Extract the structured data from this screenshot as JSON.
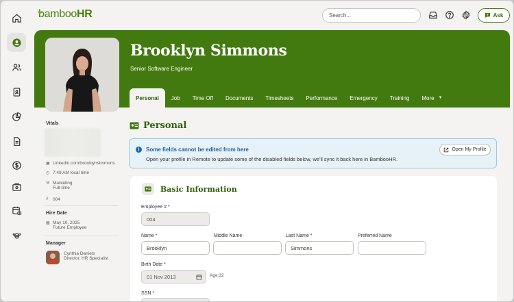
{
  "brand": {
    "logo_prefix": "bamboo",
    "logo_suffix": "HR",
    "accent": "#437a0f"
  },
  "rail": [
    {
      "icon": "home-icon"
    },
    {
      "icon": "user-circle-icon",
      "active": true
    },
    {
      "icon": "people-icon"
    },
    {
      "icon": "id-badge-icon"
    },
    {
      "icon": "pie-chart-icon"
    },
    {
      "icon": "document-icon"
    },
    {
      "icon": "dollar-icon"
    },
    {
      "icon": "payroll-icon"
    },
    {
      "icon": "calendar-clock-icon"
    },
    {
      "icon": "bee-icon"
    }
  ],
  "topbar": {
    "search_placeholder": "Search...",
    "ask_label": "Ask"
  },
  "profile": {
    "name": "Brooklyn Simmons",
    "job_title": "Senior Software Engineer"
  },
  "tabs": [
    {
      "label": "Personal",
      "active": true
    },
    {
      "label": "Job"
    },
    {
      "label": "Time Off"
    },
    {
      "label": "Documents"
    },
    {
      "label": "Timesheets"
    },
    {
      "label": "Performance"
    },
    {
      "label": "Emergency"
    },
    {
      "label": "Training"
    },
    {
      "label": "More"
    }
  ],
  "sidebar": {
    "vitals_label": "Vitals",
    "linkedin": "Linkedin.com/brooklynsimmons",
    "local_time": "7:49 AM local time",
    "department": "Marketing",
    "employment_type": "Full-time",
    "employee_number": "004",
    "hire_date_label": "Hire Date",
    "hire_date": "May 10, 2025",
    "hire_status": "Future Employee",
    "manager_label": "Manager",
    "manager_name": "Cynthia Daniels",
    "manager_title": "Director, HR Specialist"
  },
  "section": {
    "title": "Personal"
  },
  "notice": {
    "title": "Some fields cannot be edited from here",
    "body": "Open your profile in Remote to update some of the disabled fields below, we'll sync it back here in BambooHR.",
    "button_label": "Open My Profile",
    "color": "#1d6db3"
  },
  "basic_info": {
    "title": "Basic Information",
    "employee_number_label": "Employee # *",
    "employee_number_value": "004",
    "name_label": "Name *",
    "name_value": "Brooklyn",
    "middle_name_label": "Middle Name",
    "middle_name_value": "",
    "last_name_label": "Last Name *",
    "last_name_value": "Simmons",
    "preferred_name_label": "Preferred Name",
    "preferred_name_value": "",
    "birth_date_label": "Birth Date *",
    "birth_date_value": "01 Nov 2013",
    "age_text": "Age:32",
    "ssn_label": "SSN *"
  }
}
